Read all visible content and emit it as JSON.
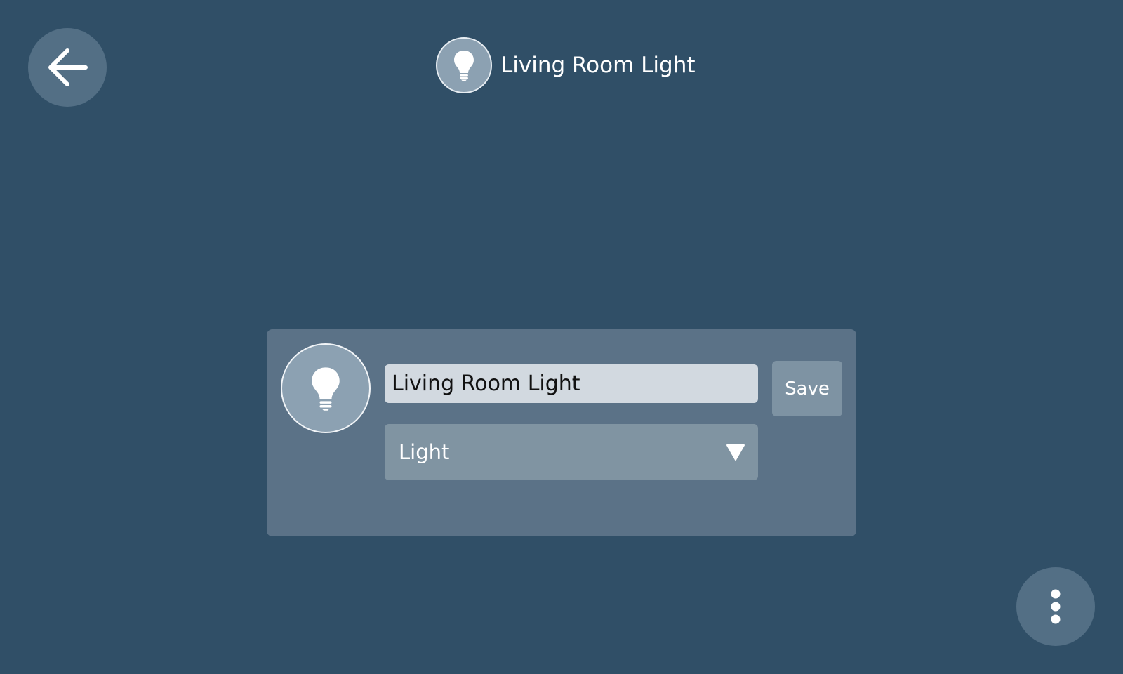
{
  "header": {
    "title": "Living Room Light",
    "icon": "lightbulb-icon"
  },
  "navigation": {
    "back_icon": "arrow-left-icon",
    "more_icon": "more-vertical-icon"
  },
  "editor": {
    "icon": "lightbulb-icon",
    "name_value": "Living Room Light",
    "type_selected": "Light",
    "dropdown_icon": "triangle-down-icon",
    "save_label": "Save"
  },
  "colors": {
    "background": "#304f67",
    "card": "#5b7287",
    "button": "#536f85",
    "input": "#d2d9e0",
    "select": "#8094a2"
  }
}
